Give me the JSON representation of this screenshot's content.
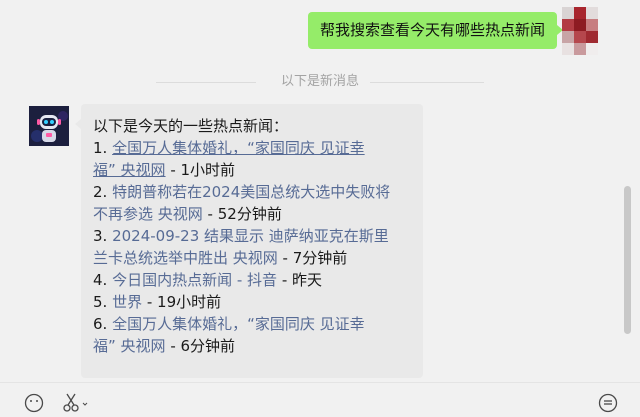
{
  "outgoing_message": "帮我搜索查看今天有哪些热点新闻",
  "divider_text": "以下是新消息",
  "reply": {
    "intro": "以下是今天的一些热点新闻：",
    "items": [
      {
        "num": "1.",
        "line1_link": "全国万人集体婚礼，“家国同庆 见证幸",
        "line2_link": "福” 央视网",
        "time": " - 1小时前"
      },
      {
        "num": "2.",
        "line1_link": "特朗普称若在2024美国总统大选中失败将",
        "line2_link": "不再参选 央视网",
        "time": " - 52分钟前"
      },
      {
        "num": "3.",
        "line1_link": "2024-09-23 结果显示 迪萨纳亚克在斯里",
        "line2_link": "兰卡总统选举中胜出 央视网",
        "time": " - 7分钟前"
      },
      {
        "num": "4.",
        "line1_link": "今日国内热点新闻 - 抖音",
        "time": " - 昨天"
      },
      {
        "num": "5.",
        "line1_link": "世界",
        "time": " - 19小时前"
      },
      {
        "num": "6.",
        "line1_link": "全国万人集体婚礼，“家国同庆 见证幸",
        "line2_link": "福” 央视网",
        "time": " - 6分钟前"
      }
    ]
  },
  "icons": {
    "bot_avatar": "robot-avatar-icon",
    "my_avatar": "user-avatar-icon",
    "emoji": "emoji-icon",
    "scissors": "scissors-icon",
    "history": "chat-history-icon"
  },
  "colors": {
    "outgoing_bubble": "#95ec69",
    "incoming_bubble": "#e9e9e9",
    "link": "#576b95",
    "background": "#f1f1f1"
  }
}
